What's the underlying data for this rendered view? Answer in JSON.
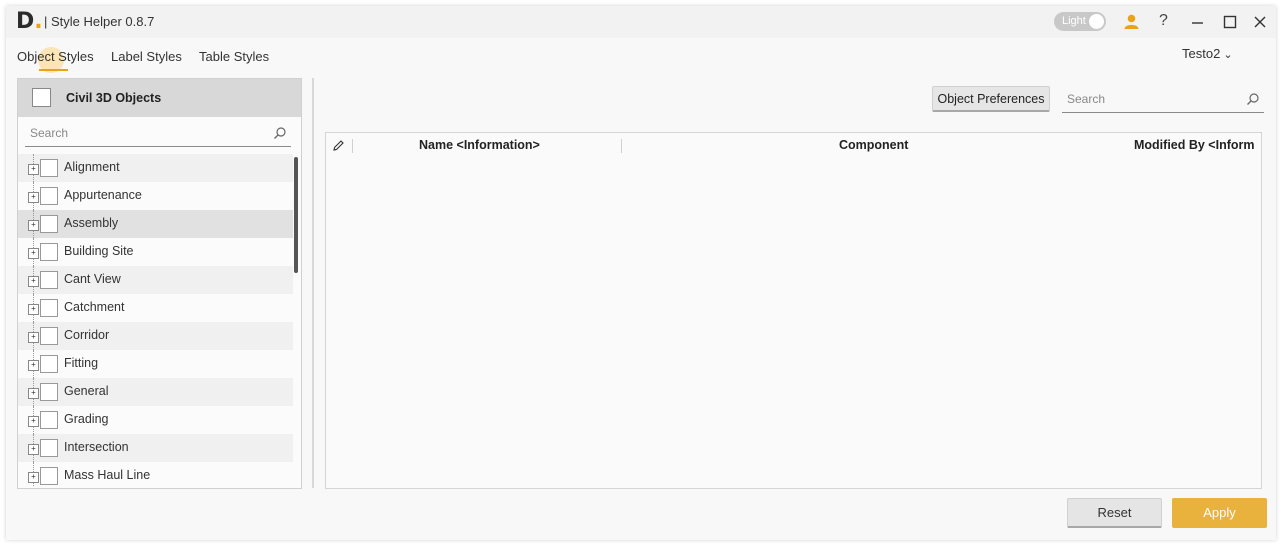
{
  "titlebar": {
    "logo_letter": "D",
    "logo_dot": ".",
    "app_title": "| Style Helper 0.8.7",
    "theme_toggle_label": "Light",
    "help_label": "?"
  },
  "tabs": [
    {
      "label": "Object Styles",
      "active": true
    },
    {
      "label": "Label Styles",
      "active": false
    },
    {
      "label": "Table Styles",
      "active": false
    }
  ],
  "profile": {
    "label": "Testo2"
  },
  "left_panel": {
    "header_title": "Civil 3D Objects",
    "search_placeholder": "Search",
    "items": [
      {
        "label": "Alignment"
      },
      {
        "label": "Appurtenance"
      },
      {
        "label": "Assembly",
        "selected": true
      },
      {
        "label": "Building Site"
      },
      {
        "label": "Cant View"
      },
      {
        "label": "Catchment"
      },
      {
        "label": "Corridor"
      },
      {
        "label": "Fitting"
      },
      {
        "label": "General"
      },
      {
        "label": "Grading"
      },
      {
        "label": "Intersection"
      },
      {
        "label": "Mass Haul Line"
      }
    ]
  },
  "right_panel": {
    "preferences_button": "Object Preferences",
    "search_placeholder": "Search",
    "columns": [
      "Name <Information>",
      "Component",
      "Modified By <Inform"
    ]
  },
  "footer": {
    "reset_label": "Reset",
    "apply_label": "Apply"
  },
  "colors": {
    "accent": "#e8a317",
    "apply_button": "#e8b23c"
  }
}
